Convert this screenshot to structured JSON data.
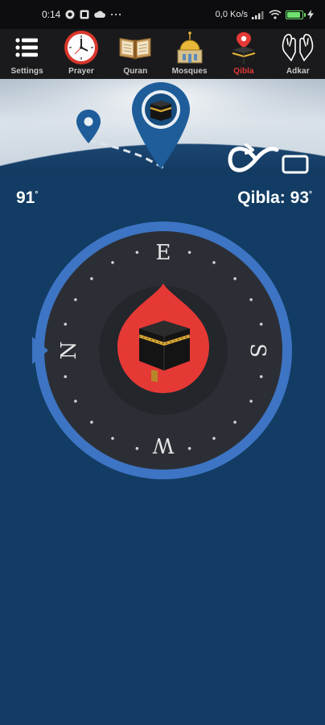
{
  "status_bar": {
    "time": "0:14",
    "speed": "0,0 Ko/s",
    "dots": "···"
  },
  "nav": {
    "items": [
      {
        "label": "Settings",
        "icon": "menu-icon"
      },
      {
        "label": "Prayer",
        "icon": "clock-icon"
      },
      {
        "label": "Quran",
        "icon": "book-icon"
      },
      {
        "label": "Mosques",
        "icon": "mosque-icon"
      },
      {
        "label": "Qibla",
        "icon": "kaaba-pin-icon",
        "active": true
      },
      {
        "label": "Adkar",
        "icon": "praying-hands-icon"
      }
    ]
  },
  "readout": {
    "heading": "91",
    "qibla": "Qibla: 93",
    "degree_mark": "°"
  },
  "compass": {
    "cardinals": {
      "north": "N",
      "east": "E",
      "south": "S",
      "west": "W"
    },
    "ring_color": "#3d74c4",
    "needle_color": "#e53935",
    "dial_color": "#2b2f35"
  },
  "colors": {
    "background": "#123c63",
    "accent": "#e53935"
  }
}
